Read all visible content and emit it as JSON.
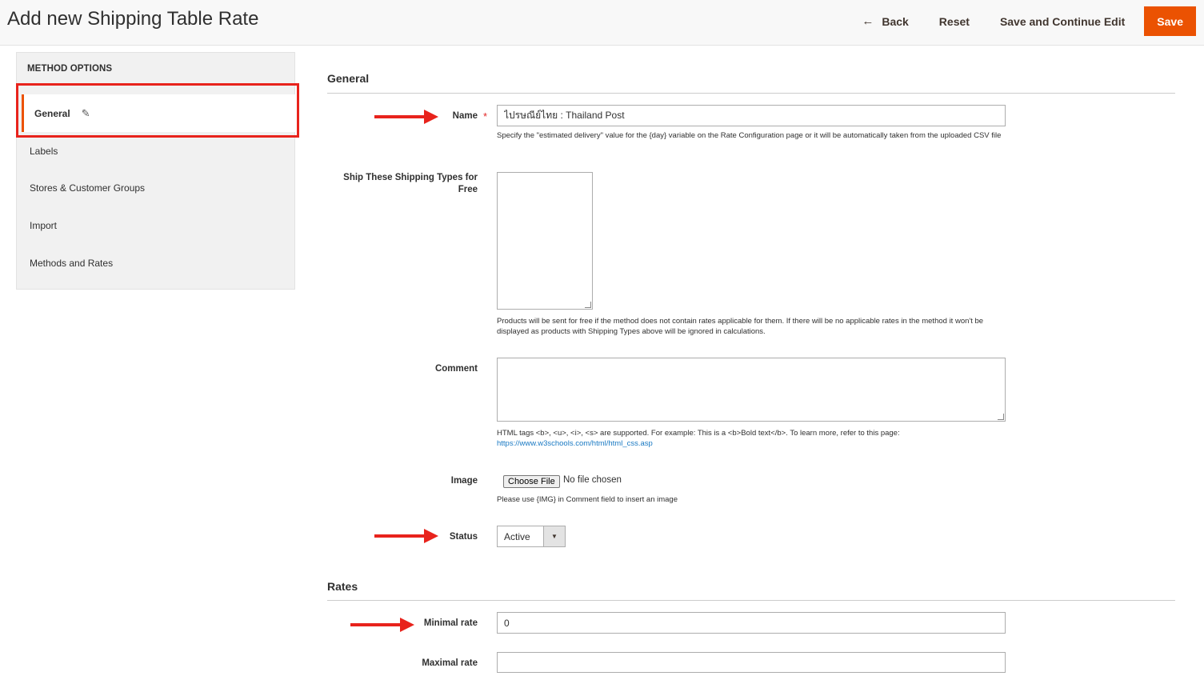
{
  "header": {
    "title": "Add new Shipping Table Rate",
    "back_label": "Back",
    "reset_label": "Reset",
    "save_continue_label": "Save and Continue Edit",
    "save_label": "Save"
  },
  "sidebar": {
    "title": "METHOD OPTIONS",
    "items": [
      {
        "label": "General",
        "active": true
      },
      {
        "label": "Labels"
      },
      {
        "label": "Stores & Customer Groups"
      },
      {
        "label": "Import"
      },
      {
        "label": "Methods and Rates"
      }
    ]
  },
  "general": {
    "section_title": "General",
    "name": {
      "label": "Name",
      "value": "ไปรษณีย์ไทย : Thailand Post",
      "note": "Specify the \"estimated delivery\" value for the {day} variable on the Rate Configuration page or it will be automatically taken from the uploaded CSV file"
    },
    "ship_free": {
      "label": "Ship These Shipping Types for Free",
      "note": "Products will be sent for free if the method does not contain rates applicable for them. If there will be no applicable rates in the method it won't be displayed as products with Shipping Types above will be ignored in calculations."
    },
    "comment": {
      "label": "Comment",
      "note": "HTML tags <b>, <u>, <i>, <s> are supported. For example: This is a <b>Bold text</b>. To learn more, refer to this page:",
      "link": "https://www.w3schools.com/html/html_css.asp"
    },
    "image": {
      "label": "Image",
      "button_label": "Choose File",
      "status_text": "No file chosen",
      "note": "Please use {IMG} in Comment field to insert an image"
    },
    "status": {
      "label": "Status",
      "value": "Active"
    }
  },
  "rates": {
    "section_title": "Rates",
    "minimal_rate": {
      "label": "Minimal rate",
      "value": "0"
    },
    "maximal_rate": {
      "label": "Maximal rate",
      "value": ""
    }
  },
  "colors": {
    "accent": "#eb5202",
    "annotation_red": "#e8231c",
    "link": "#1979c3"
  }
}
